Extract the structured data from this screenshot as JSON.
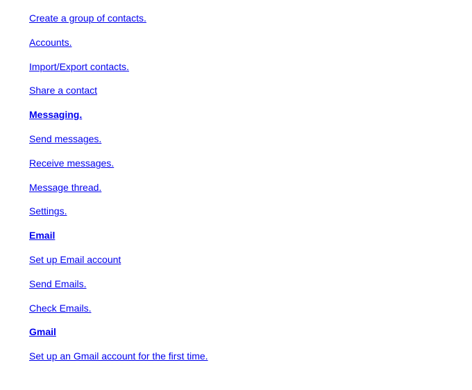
{
  "toc": [
    {
      "label": "Create a group of contacts.  ",
      "bold": false
    },
    {
      "label": "Accounts.  ",
      "bold": false
    },
    {
      "label": "Import/Export contacts.  ",
      "bold": false
    },
    {
      "label": "Share a contact",
      "bold": false
    },
    {
      "label": "Messaging.  ",
      "bold": true
    },
    {
      "label": "Send messages.  ",
      "bold": false
    },
    {
      "label": "Receive messages.  ",
      "bold": false
    },
    {
      "label": "Message thread.  ",
      "bold": false
    },
    {
      "label": "Settings.  ",
      "bold": false
    },
    {
      "label": "Email",
      "bold": true
    },
    {
      "label": "Set up Email account",
      "bold": false
    },
    {
      "label": "Send Emails.  ",
      "bold": false
    },
    {
      "label": "Check Emails.  ",
      "bold": false
    },
    {
      "label": "Gmail",
      "bold": true
    },
    {
      "label": "Set up an Gmail account for the first time.  ",
      "bold": false
    }
  ]
}
